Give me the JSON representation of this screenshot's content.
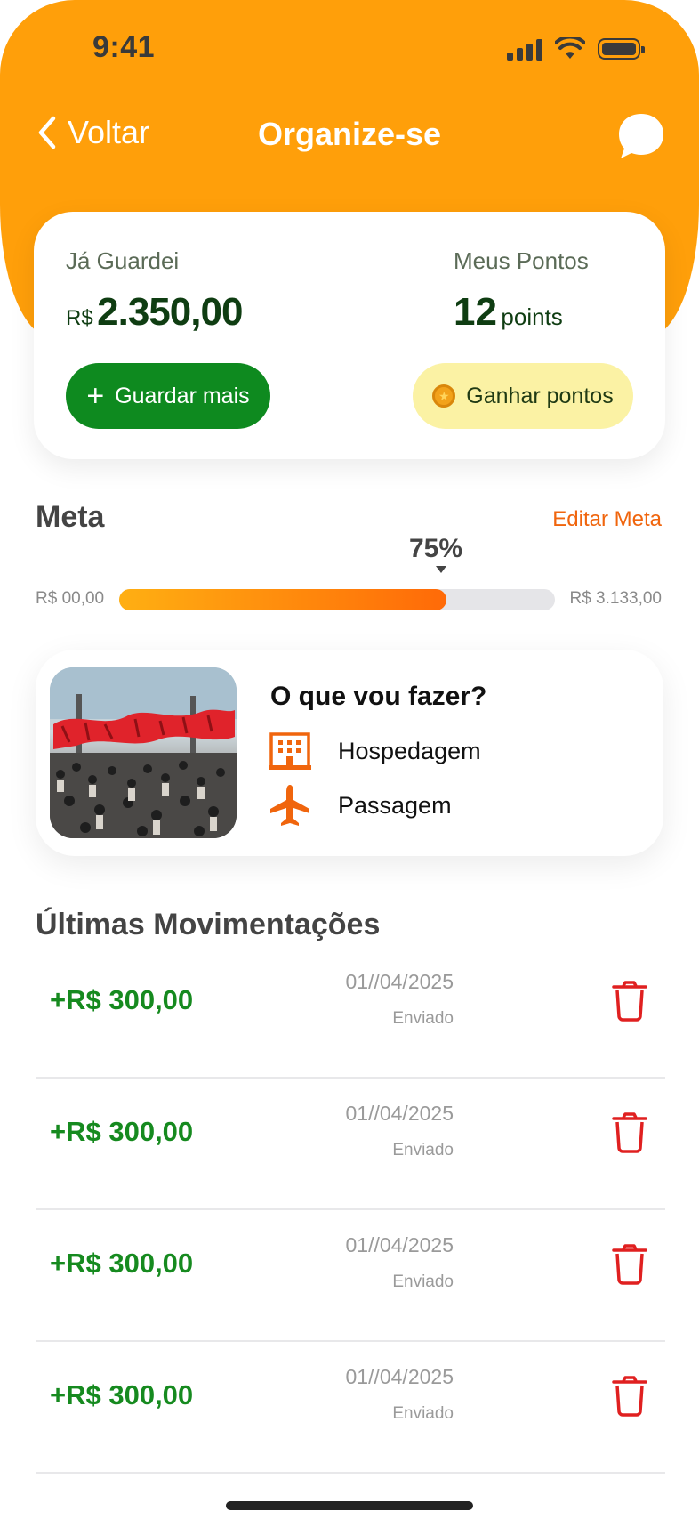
{
  "status": {
    "time": "9:41"
  },
  "nav": {
    "back_label": "Voltar",
    "title": "Organize-se"
  },
  "balance": {
    "saved_label": "Já Guardei",
    "currency": "R$",
    "saved_value": "2.350,00",
    "points_label": "Meus Pontos",
    "points_value": "12",
    "points_unit": "points",
    "save_more_label": "Guardar mais",
    "earn_points_label": "Ganhar pontos"
  },
  "goal": {
    "title": "Meta",
    "edit_label": "Editar Meta",
    "percent_label": "75%",
    "progress": 0.75,
    "min_label": "R$ 00,00",
    "max_label": "R$ 3.133,00"
  },
  "plan": {
    "question": "O que vou fazer?",
    "items": [
      {
        "label": "Hospedagem",
        "icon": "hotel-icon"
      },
      {
        "label": "Passagem",
        "icon": "airplane-icon"
      }
    ],
    "image_alt": "Rock in Rio"
  },
  "movements": {
    "title": "Últimas Movimentações",
    "rows": [
      {
        "amount": "+R$ 300,00",
        "date": "01//04/2025",
        "status": "Enviado"
      },
      {
        "amount": "+R$ 300,00",
        "date": "01//04/2025",
        "status": "Enviado"
      },
      {
        "amount": "+R$ 300,00",
        "date": "01//04/2025",
        "status": "Enviado"
      },
      {
        "amount": "+R$ 300,00",
        "date": "01//04/2025",
        "status": "Enviado"
      }
    ]
  },
  "colors": {
    "header": "#FF9F0A",
    "primary_green": "#0E8A1F",
    "accent_orange": "#F0650D",
    "delete_red": "#E02020"
  }
}
